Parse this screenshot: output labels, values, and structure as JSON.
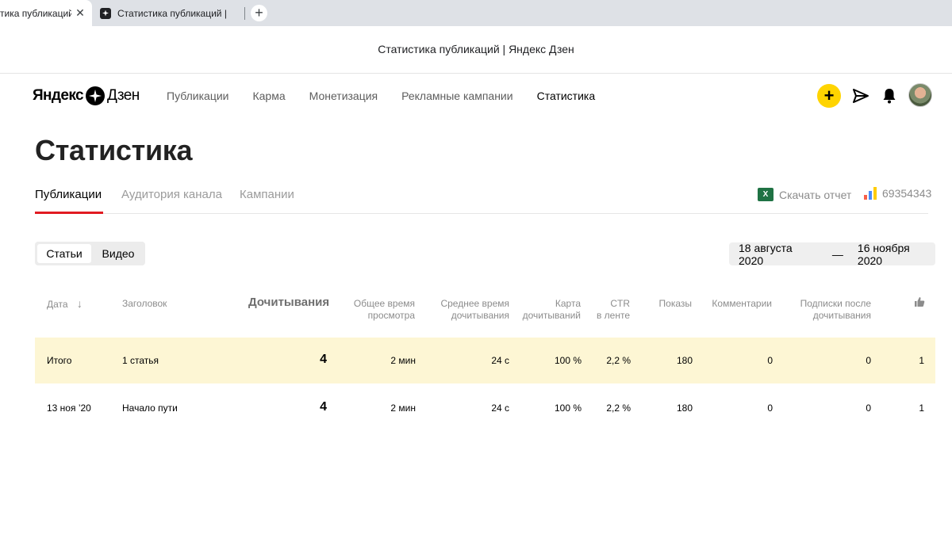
{
  "browser": {
    "active_tab_title": "тика публикаций",
    "inactive_tab_title": "Статистика публикаций | Я",
    "window_title": "Статистика публикаций | Яндекс Дзен"
  },
  "header": {
    "logo_a": "Яндекс",
    "logo_b": "Дзен",
    "nav": [
      "Публикации",
      "Карма",
      "Монетизация",
      "Рекламные кампании",
      "Статистика"
    ],
    "active_nav": "Статистика",
    "plus_label": "+"
  },
  "page": {
    "title": "Статистика",
    "tabs": [
      "Публикации",
      "Аудитория канала",
      "Кампании"
    ],
    "download_report": "Скачать отчет",
    "xls_label": "X",
    "metrika_id": "69354343"
  },
  "filter": {
    "types": [
      "Статьи",
      "Видео"
    ],
    "date_from": "18 августа 2020",
    "date_sep": "—",
    "date_to": "16 ноября 2020"
  },
  "table": {
    "headers": {
      "date": "Дата",
      "title": "Заголовок",
      "reads": "Дочитывания",
      "total_time_1": "Общее время",
      "total_time_2": "просмотра",
      "avg_time_1": "Среднее время",
      "avg_time_2": "дочитывания",
      "read_map_1": "Карта",
      "read_map_2": "дочитываний",
      "ctr_1": "CTR",
      "ctr_2": "в ленте",
      "views": "Показы",
      "comments": "Комментарии",
      "subs_1": "Подписки после",
      "subs_2": "дочитывания"
    },
    "total": {
      "date": "Итого",
      "title": "1 статья",
      "reads": "4",
      "total_time": "2 мин",
      "avg_time": "24 с",
      "read_map": "100 %",
      "ctr": "2,2 %",
      "views": "180",
      "comments": "0",
      "subs": "0",
      "likes": "1"
    },
    "rows": [
      {
        "date": "13 ноя ’20",
        "title": "Начало пути",
        "reads": "4",
        "total_time": "2 мин",
        "avg_time": "24 с",
        "read_map": "100 %",
        "ctr": "2,2 %",
        "views": "180",
        "comments": "0",
        "subs": "0",
        "likes": "1"
      }
    ]
  },
  "colors": {
    "accent_yellow": "#ffd400",
    "tab_underline": "#e11b22",
    "total_row_bg": "#fdf6d4"
  }
}
